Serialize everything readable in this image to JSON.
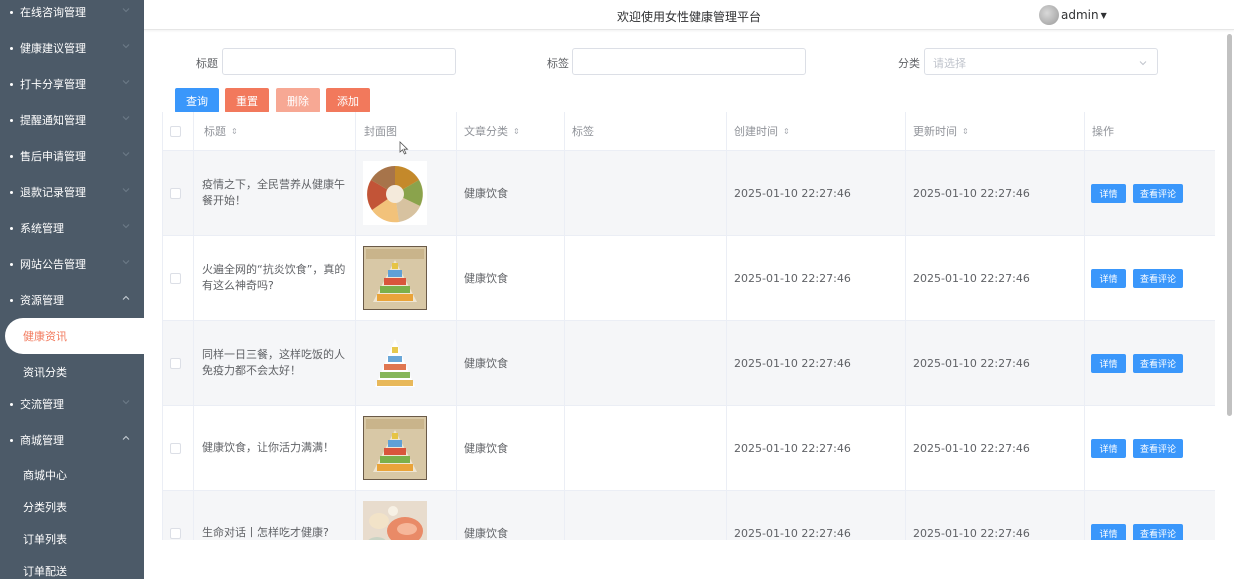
{
  "sidebar": {
    "items": [
      {
        "label": "在线咨询管理",
        "expanded": false
      },
      {
        "label": "健康建议管理",
        "expanded": false
      },
      {
        "label": "打卡分享管理",
        "expanded": false
      },
      {
        "label": "提醒通知管理",
        "expanded": false
      },
      {
        "label": "售后申请管理",
        "expanded": false
      },
      {
        "label": "退款记录管理",
        "expanded": false
      },
      {
        "label": "系统管理",
        "expanded": false
      },
      {
        "label": "网站公告管理",
        "expanded": false
      },
      {
        "label": "资源管理",
        "expanded": true
      },
      {
        "label": "交流管理",
        "expanded": false
      },
      {
        "label": "商城管理",
        "expanded": true
      }
    ],
    "resource_sub": [
      "健康资讯",
      "资讯分类"
    ],
    "mall_sub": [
      "商城中心",
      "分类列表",
      "订单列表",
      "订单配送"
    ],
    "active": "健康资讯"
  },
  "header": {
    "title": "欢迎使用女性健康管理平台",
    "user": "admin"
  },
  "search": {
    "title_label": "标题",
    "title_value": "",
    "tag_label": "标签",
    "tag_value": "",
    "category_label": "分类",
    "category_placeholder": "请选择"
  },
  "buttons": {
    "query": "查询",
    "reset": "重置",
    "delete": "删除",
    "add": "添加"
  },
  "colors": {
    "primary": "#3a97fb",
    "accent": "#f2795c",
    "accent_disabled": "#f7a894",
    "sidebar_bg": "#4c5a68"
  },
  "table": {
    "columns": {
      "title": "标题",
      "cover": "封面图",
      "category": "文章分类",
      "tags": "标签",
      "created": "创建时间",
      "updated": "更新时间",
      "actions": "操作"
    },
    "rows": [
      {
        "title": "疫情之下，全民营养从健康午餐开始！",
        "cover": "food-plate",
        "category": "健康饮食",
        "tags": "",
        "created": "2025-01-10 22:27:46",
        "updated": "2025-01-10 22:27:46"
      },
      {
        "title": "火遍全网的“抗炎饮食”，真的有这么神奇吗?",
        "cover": "food-pyramid-poster",
        "category": "健康饮食",
        "tags": "",
        "created": "2025-01-10 22:27:46",
        "updated": "2025-01-10 22:27:46"
      },
      {
        "title": "同样一日三餐，这样吃饭的人免疫力都不会太好！",
        "cover": "food-pyramid",
        "category": "健康饮食",
        "tags": "",
        "created": "2025-01-10 22:27:46",
        "updated": "2025-01-10 22:27:46"
      },
      {
        "title": "健康饮食，让你活力满满！",
        "cover": "food-pyramid-poster",
        "category": "健康饮食",
        "tags": "",
        "created": "2025-01-10 22:27:46",
        "updated": "2025-01-10 22:27:46"
      },
      {
        "title": "生命对话丨怎样吃才健康?",
        "cover": "food-photo",
        "category": "健康饮食",
        "tags": "",
        "created": "2025-01-10 22:27:46",
        "updated": "2025-01-10 22:27:46"
      }
    ],
    "detail_label": "详情",
    "comments_label": "查看评论"
  }
}
